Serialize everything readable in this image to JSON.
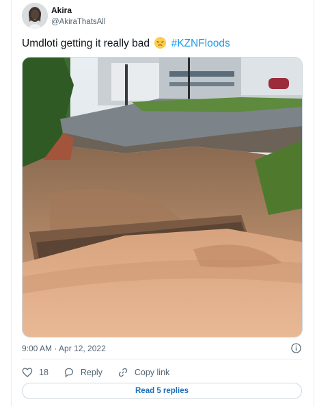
{
  "author": {
    "name": "Akira",
    "handle": "@AkiraThatsAll"
  },
  "tweet": {
    "text": "Umdloti getting it really bad",
    "emoji": "pensive-face",
    "hashtag": "#KZNFloods"
  },
  "timestamp": "9:00 AM · Apr 12, 2022",
  "actions": {
    "like_count": "18",
    "reply_label": "Reply",
    "copy_link_label": "Copy link"
  },
  "read_replies_label": "Read 5 replies",
  "colors": {
    "link": "#1d9bf0",
    "text": "#0f1419",
    "muted": "#536471",
    "border": "#cfd9de"
  },
  "icons": [
    "heart-icon",
    "reply-icon",
    "link-icon",
    "info-icon"
  ]
}
